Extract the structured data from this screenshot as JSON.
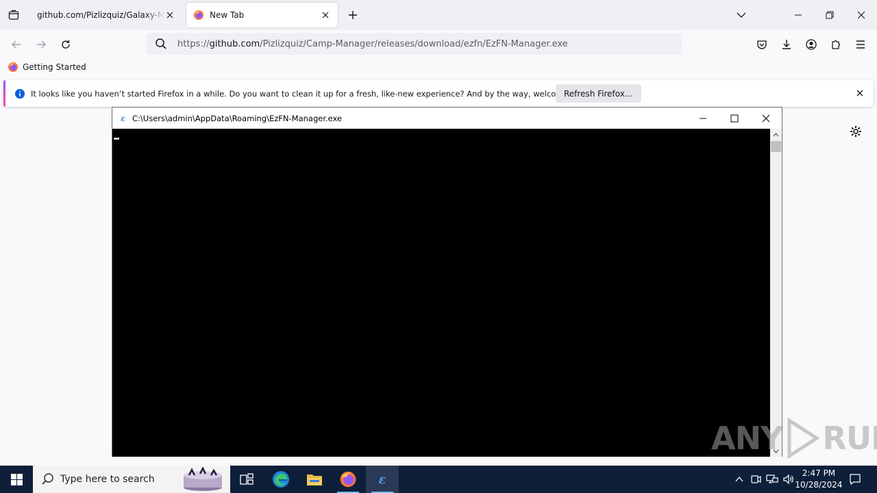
{
  "browser": {
    "tabs": [
      {
        "title": "github.com/Pizlizquiz/Galaxy-Manager",
        "active": false
      },
      {
        "title": "New Tab",
        "active": true
      }
    ],
    "url": {
      "scheme": "https://",
      "host": "github.com",
      "path": "/Pizlizquiz/Camp-Manager/releases/download/ezfn/EzFN-Manager.exe"
    },
    "bookmarks": [
      {
        "label": "Getting Started"
      }
    ],
    "notification": {
      "message": "It looks like you haven’t started Firefox in a while. Do you want to clean it up for a fresh, like-new experience? And by the way, welcome back!",
      "button_label": "Refresh Firefox…"
    }
  },
  "console": {
    "title": "C:\\Users\\admin\\AppData\\Roaming\\EzFN-Manager.exe",
    "app_icon_glyph": "ε"
  },
  "watermark": {
    "left": "ANY",
    "right": "RUN"
  },
  "taskbar": {
    "search_placeholder": "Type here to search",
    "apps": [
      "task-view",
      "edge",
      "file-explorer",
      "firefox",
      "ezfn-manager"
    ],
    "ezfn_glyph": "ε",
    "clock": {
      "time": "2:47 PM",
      "date": "10/28/2024"
    }
  },
  "colors": {
    "accent_purple": "#9059ff",
    "accent_pink": "#ff4aa2",
    "taskbar_bg": "#0e1f3a",
    "console_bg": "#000000"
  }
}
